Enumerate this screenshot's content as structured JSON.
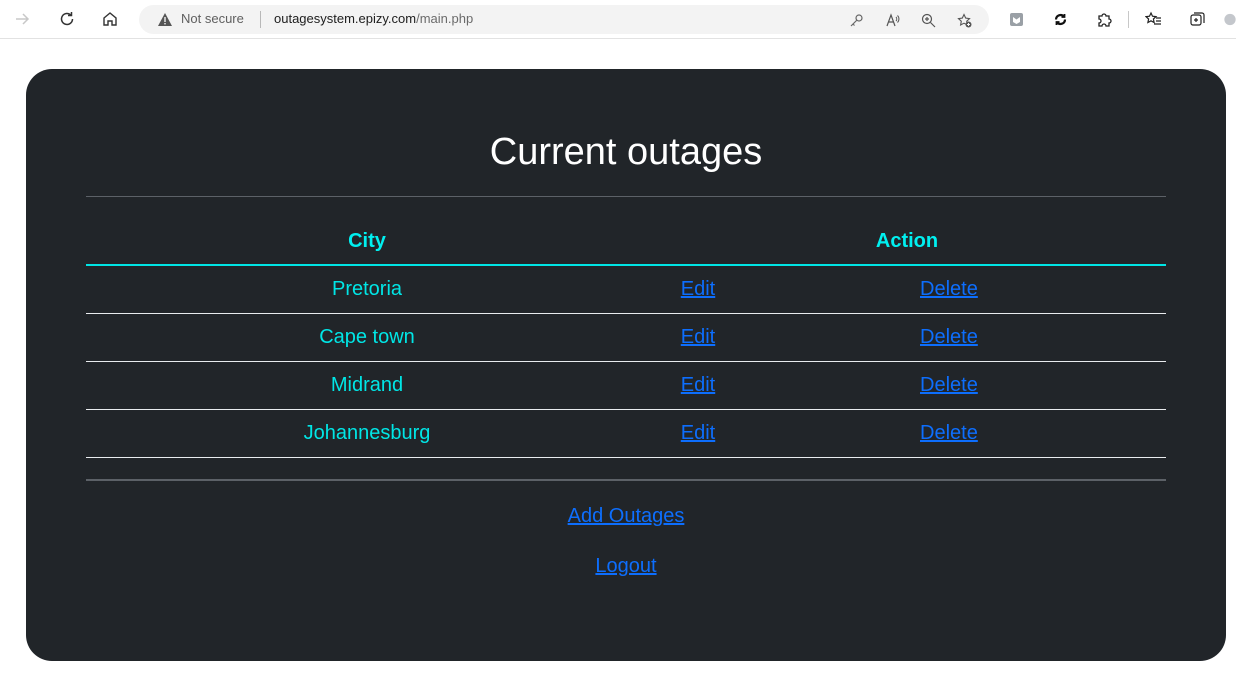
{
  "browser": {
    "security_label": "Not secure",
    "url_host": "outagesystem.epizy.com",
    "url_path": "/main.php"
  },
  "page": {
    "heading": "Current outages",
    "table": {
      "headers": {
        "city": "City",
        "action": "Action"
      },
      "rows": [
        {
          "city": "Pretoria",
          "edit": "Edit",
          "delete": "Delete"
        },
        {
          "city": "Cape town",
          "edit": "Edit",
          "delete": "Delete"
        },
        {
          "city": "Midrand",
          "edit": "Edit",
          "delete": "Delete"
        },
        {
          "city": "Johannesburg",
          "edit": "Edit",
          "delete": "Delete"
        }
      ]
    },
    "links": {
      "add_outages": "Add Outages",
      "logout": "Logout"
    }
  },
  "colors": {
    "card_bg": "#212529",
    "accent_cyan": "#00f0f0",
    "link_blue": "#0d6efd"
  }
}
